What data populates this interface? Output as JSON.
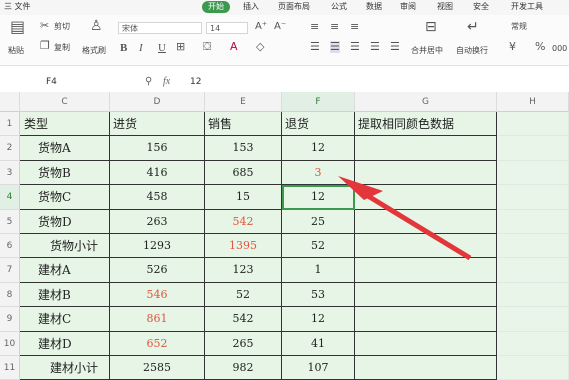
{
  "menubar": {
    "file": "三 文件",
    "start": "开始",
    "insert": "插入",
    "layout": "页面布局",
    "formula": "公式",
    "data": "数据",
    "review": "审阅",
    "view": "视图",
    "security": "安全",
    "dev": "开发工具"
  },
  "ribbon": {
    "paste": "粘贴",
    "cut": "剪切",
    "copy": "复制",
    "format_painter": "格式刷",
    "font_name": "宋体",
    "font_size": "14",
    "bold": "B",
    "italic": "I",
    "underline": "U",
    "merge_center": "合并居中",
    "wrap_text": "自动换行",
    "number_format": "常规",
    "percent": "%",
    "thousands": "000"
  },
  "formula_bar": {
    "name_box": "F4",
    "fx_label": "fx",
    "value": "12"
  },
  "columns": [
    "C",
    "D",
    "E",
    "F",
    "G",
    "H"
  ],
  "rows": [
    {
      "num": "1",
      "c": "类型",
      "d": "进货",
      "e": "销售",
      "f": "退货",
      "g": "提取相同颜色数据",
      "d_red": false,
      "e_red": false,
      "f_red": false
    },
    {
      "num": "2",
      "c": "货物A",
      "d": "156",
      "e": "153",
      "f": "12",
      "g": "",
      "d_red": false,
      "e_red": false,
      "f_red": false
    },
    {
      "num": "3",
      "c": "货物B",
      "d": "416",
      "e": "685",
      "f": "3",
      "g": "",
      "d_red": false,
      "e_red": false,
      "f_red": true
    },
    {
      "num": "4",
      "c": "货物C",
      "d": "458",
      "e": "15",
      "f": "12",
      "g": "",
      "d_red": false,
      "e_red": false,
      "f_red": false
    },
    {
      "num": "5",
      "c": "货物D",
      "d": "263",
      "e": "542",
      "f": "25",
      "g": "",
      "d_red": false,
      "e_red": true,
      "f_red": false
    },
    {
      "num": "6",
      "c": "货物小计",
      "d": "1293",
      "e": "1395",
      "f": "52",
      "g": "",
      "d_red": false,
      "e_red": true,
      "f_red": false
    },
    {
      "num": "7",
      "c": "建材A",
      "d": "526",
      "e": "123",
      "f": "1",
      "g": "",
      "d_red": false,
      "e_red": false,
      "f_red": false
    },
    {
      "num": "8",
      "c": "建材B",
      "d": "546",
      "e": "52",
      "f": "53",
      "g": "",
      "d_red": true,
      "e_red": false,
      "f_red": false
    },
    {
      "num": "9",
      "c": "建材C",
      "d": "861",
      "e": "542",
      "f": "12",
      "g": "",
      "d_red": true,
      "e_red": false,
      "f_red": false
    },
    {
      "num": "10",
      "c": "建材D",
      "d": "652",
      "e": "265",
      "f": "41",
      "g": "",
      "d_red": true,
      "e_red": false,
      "f_red": false
    },
    {
      "num": "11",
      "c": "建材小计",
      "d": "2585",
      "e": "982",
      "f": "107",
      "g": "",
      "d_red": false,
      "e_red": false,
      "f_red": false
    }
  ],
  "selected_cell": "F4",
  "annotation": {
    "color": "#e2363b",
    "type": "arrow"
  }
}
